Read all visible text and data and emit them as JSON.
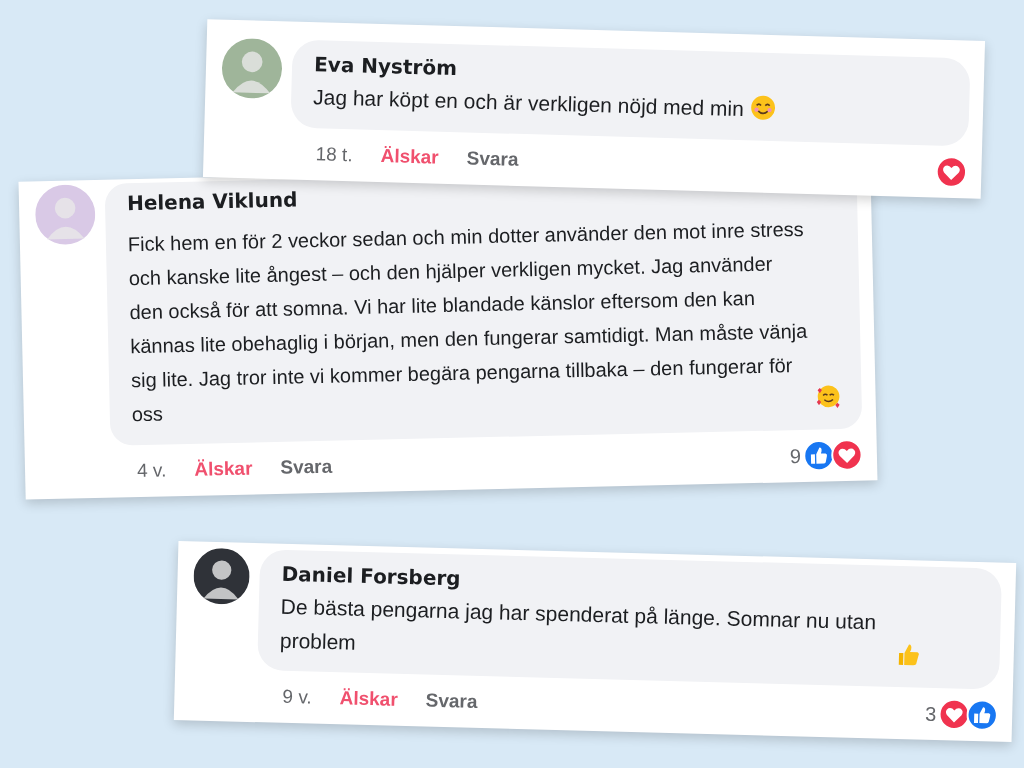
{
  "comments": [
    {
      "name": "Eva Nyström",
      "text": "Jag har köpt en och är verkligen nöjd med min",
      "emoji": {
        "kind": "smiling"
      },
      "time": "18 t.",
      "reaction_label": "Älskar",
      "reacted": true,
      "reply_label": "Svara",
      "reactions": [
        {
          "kind": "love"
        }
      ]
    },
    {
      "name": "Helena Viklund",
      "text": "Fick hem en för 2 veckor sedan och min dotter använder den mot inre stress och kanske lite ångest – och den hjälper verkligen mycket. Jag använder den också för att somna. Vi har lite blandade känslor eftersom den kan kännas lite obehaglig i början, men den fungerar samtidigt. Man måste vänja sig lite. Jag tror inte vi kommer begära pengarna tillbaka – den fungerar för oss",
      "emoji": {
        "kind": "hearts"
      },
      "time": "4 v.",
      "reaction_label": "Älskar",
      "reacted": true,
      "reply_label": "Svara",
      "count": "9",
      "reactions": [
        {
          "kind": "like"
        },
        {
          "kind": "love"
        }
      ]
    },
    {
      "name": "Daniel Forsberg",
      "text": "De bästa pengarna jag har spenderat på länge. Somnar nu utan problem",
      "emoji": {
        "kind": "thumbs-up"
      },
      "time": "9 v.",
      "reaction_label": "Älskar",
      "reacted": true,
      "reply_label": "Svara",
      "count": "3",
      "reactions": [
        {
          "kind": "love"
        },
        {
          "kind": "like"
        }
      ]
    }
  ]
}
